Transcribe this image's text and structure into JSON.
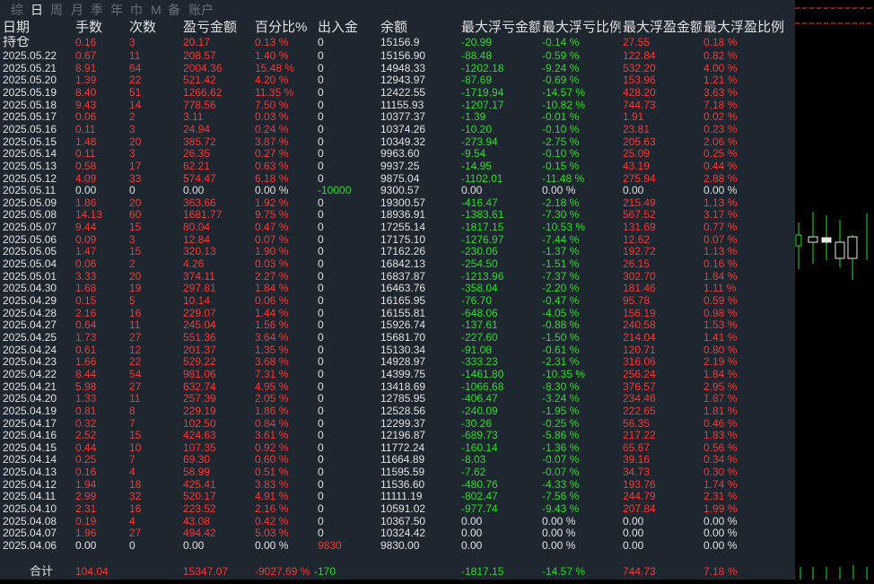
{
  "tabs": [
    {
      "label": "综",
      "active": false
    },
    {
      "label": "日",
      "active": true
    },
    {
      "label": "周",
      "active": false
    },
    {
      "label": "月",
      "active": false
    },
    {
      "label": "季",
      "active": false
    },
    {
      "label": "年",
      "active": false
    },
    {
      "label": "巾",
      "active": false
    },
    {
      "label": "M",
      "active": false
    },
    {
      "label": "备",
      "active": false
    },
    {
      "label": "账户",
      "active": false
    }
  ],
  "headers": [
    "日期",
    "手数",
    "次数",
    "盈亏金额",
    "百分比%",
    "出入金",
    "余额",
    "最大浮亏金额",
    "最大浮亏比例",
    "最大浮盈金额",
    "最大浮盈比例"
  ],
  "holding": [
    "持仓",
    "0.16",
    "3",
    "20.17",
    "0.13 %",
    "0",
    "15156.9",
    "-20.99",
    "-0.14 %",
    "27.55",
    "0.18 %"
  ],
  "rows": [
    [
      "2025.05.22",
      "0.67",
      "11",
      "208.57",
      "1.40 %",
      "0",
      "15156.90",
      "-88.48",
      "-0.59 %",
      "122.84",
      "0.82 %"
    ],
    [
      "2025.05.21",
      "8.91",
      "64",
      "2004.36",
      "15.48 %",
      "0",
      "14948.33",
      "-1202.18",
      "-9.24 %",
      "532.20",
      "4.00 %"
    ],
    [
      "2025.05.20",
      "1.39",
      "22",
      "521.42",
      "4.20 %",
      "0",
      "12943.97",
      "-87.69",
      "-0.69 %",
      "153.96",
      "1.21 %"
    ],
    [
      "2025.05.19",
      "8.40",
      "51",
      "1266.62",
      "11.35 %",
      "0",
      "12422.55",
      "-1719.94",
      "-14.57 %",
      "428.20",
      "3.63 %"
    ],
    [
      "2025.05.18",
      "9.43",
      "14",
      "778.56",
      "7.50 %",
      "0",
      "11155.93",
      "-1207.17",
      "-10.82 %",
      "744.73",
      "7.18 %"
    ],
    [
      "2025.05.17",
      "0.06",
      "2",
      "3.11",
      "0.03 %",
      "0",
      "10377.37",
      "-1.39",
      "-0.01 %",
      "1.91",
      "0.02 %"
    ],
    [
      "2025.05.16",
      "0.11",
      "3",
      "24.94",
      "0.24 %",
      "0",
      "10374.26",
      "-10.20",
      "-0.10 %",
      "23.81",
      "0.23 %"
    ],
    [
      "2025.05.15",
      "1.48",
      "20",
      "385.72",
      "3.87 %",
      "0",
      "10349.32",
      "-273.94",
      "-2.75 %",
      "205.63",
      "2.06 %"
    ],
    [
      "2025.05.14",
      "0.11",
      "3",
      "26.35",
      "0.27 %",
      "0",
      "9963.60",
      "-9.54",
      "-0.10 %",
      "25.09",
      "0.25 %"
    ],
    [
      "2025.05.13",
      "0.58",
      "17",
      "62.21",
      "0.63 %",
      "0",
      "9937.25",
      "-14.95",
      "-0.15 %",
      "43.19",
      "0.44 %"
    ],
    [
      "2025.05.12",
      "4.09",
      "33",
      "574.47",
      "6.18 %",
      "0",
      "9875.04",
      "-1102.01",
      "-11.48 %",
      "275.94",
      "2.88 %"
    ],
    [
      "2025.05.11",
      "0.00",
      "0",
      "0.00",
      "0.00 %",
      "-10000",
      "9300.57",
      "0.00",
      "0.00 %",
      "0.00",
      "0.00 %"
    ],
    [
      "2025.05.09",
      "1.86",
      "20",
      "363.66",
      "1.92 %",
      "0",
      "19300.57",
      "-416.47",
      "-2.18 %",
      "215.49",
      "1.13 %"
    ],
    [
      "2025.05.08",
      "14.13",
      "60",
      "1681.77",
      "9.75 %",
      "0",
      "18936.91",
      "-1383.61",
      "-7.30 %",
      "567.52",
      "3.17 %"
    ],
    [
      "2025.05.07",
      "9.44",
      "15",
      "80.04",
      "0.47 %",
      "0",
      "17255.14",
      "-1817.15",
      "-10.53 %",
      "131.69",
      "0.77 %"
    ],
    [
      "2025.05.06",
      "0.09",
      "3",
      "12.84",
      "0.07 %",
      "0",
      "17175.10",
      "-1276.97",
      "-7.44 %",
      "12.62",
      "0.07 %"
    ],
    [
      "2025.05.05",
      "1.47",
      "15",
      "320.13",
      "1.90 %",
      "0",
      "17162.26",
      "-230.06",
      "-1.37 %",
      "192.72",
      "1.13 %"
    ],
    [
      "2025.05.04",
      "0.06",
      "2",
      "4.26",
      "0.03 %",
      "0",
      "16842.13",
      "-254.50",
      "-1.51 %",
      "26.15",
      "0.16 %"
    ],
    [
      "2025.05.01",
      "3.33",
      "20",
      "374.11",
      "2.27 %",
      "0",
      "16837.87",
      "-1213.96",
      "-7.37 %",
      "302.70",
      "1.84 %"
    ],
    [
      "2025.04.30",
      "1.68",
      "19",
      "297.81",
      "1.84 %",
      "0",
      "16463.76",
      "-358.04",
      "-2.20 %",
      "181.46",
      "1.11 %"
    ],
    [
      "2025.04.29",
      "0.15",
      "5",
      "10.14",
      "0.06 %",
      "0",
      "16165.95",
      "-76.70",
      "-0.47 %",
      "95.78",
      "0.59 %"
    ],
    [
      "2025.04.28",
      "2.16",
      "16",
      "229.07",
      "1.44 %",
      "0",
      "16155.81",
      "-648.06",
      "-4.05 %",
      "156.19",
      "0.98 %"
    ],
    [
      "2025.04.27",
      "0.64",
      "11",
      "245.04",
      "1.56 %",
      "0",
      "15926.74",
      "-137.61",
      "-0.88 %",
      "240.58",
      "1.53 %"
    ],
    [
      "2025.04.25",
      "1.73",
      "27",
      "551.36",
      "3.64 %",
      "0",
      "15681.70",
      "-227.60",
      "-1.50 %",
      "214.04",
      "1.41 %"
    ],
    [
      "2025.04.24",
      "0.61",
      "12",
      "201.37",
      "1.35 %",
      "0",
      "15130.34",
      "-91.08",
      "-0.61 %",
      "120.71",
      "0.80 %"
    ],
    [
      "2025.04.23",
      "1.66",
      "22",
      "529.22",
      "3.68 %",
      "0",
      "14928.97",
      "-333.23",
      "-2.31 %",
      "316.06",
      "2.19 %"
    ],
    [
      "2025.04.22",
      "8.44",
      "54",
      "981.06",
      "7.31 %",
      "0",
      "14399.75",
      "-1461.80",
      "-10.35 %",
      "256.24",
      "1.84 %"
    ],
    [
      "2025.04.21",
      "5.98",
      "27",
      "632.74",
      "4.95 %",
      "0",
      "13418.69",
      "-1066.68",
      "-8.30 %",
      "376.57",
      "2.95 %"
    ],
    [
      "2025.04.20",
      "1.33",
      "11",
      "257.39",
      "2.05 %",
      "0",
      "12785.95",
      "-406.47",
      "-3.24 %",
      "234.46",
      "1.87 %"
    ],
    [
      "2025.04.19",
      "0.81",
      "8",
      "229.19",
      "1.86 %",
      "0",
      "12528.56",
      "-240.09",
      "-1.95 %",
      "222.65",
      "1.81 %"
    ],
    [
      "2025.04.17",
      "0.32",
      "7",
      "102.50",
      "0.84 %",
      "0",
      "12299.37",
      "-30.26",
      "-0.25 %",
      "56.35",
      "0.46 %"
    ],
    [
      "2025.04.16",
      "2.52",
      "15",
      "424.63",
      "3.61 %",
      "0",
      "12196.87",
      "-689.73",
      "-5.86 %",
      "217.22",
      "1.83 %"
    ],
    [
      "2025.04.15",
      "0.44",
      "10",
      "107.35",
      "0.92 %",
      "0",
      "11772.24",
      "-160.14",
      "-1.36 %",
      "65.67",
      "0.56 %"
    ],
    [
      "2025.04.14",
      "0.25",
      "7",
      "69.30",
      "0.60 %",
      "0",
      "11664.89",
      "-8.03",
      "-0.07 %",
      "39.16",
      "0.34 %"
    ],
    [
      "2025.04.13",
      "0.16",
      "4",
      "58.99",
      "0.51 %",
      "0",
      "11595.59",
      "-7.62",
      "-0.07 %",
      "34.73",
      "0.30 %"
    ],
    [
      "2025.04.12",
      "1.94",
      "18",
      "425.41",
      "3.83 %",
      "0",
      "11536.60",
      "-480.76",
      "-4.33 %",
      "193.76",
      "1.74 %"
    ],
    [
      "2025.04.11",
      "2.99",
      "32",
      "520.17",
      "4.91 %",
      "0",
      "11111.19",
      "-802.47",
      "-7.56 %",
      "244.79",
      "2.31 %"
    ],
    [
      "2025.04.10",
      "2.31",
      "16",
      "223.52",
      "2.16 %",
      "0",
      "10591.02",
      "-977.74",
      "-9.43 %",
      "207.84",
      "1.99 %"
    ],
    [
      "2025.04.08",
      "0.19",
      "4",
      "43.08",
      "0.42 %",
      "0",
      "10367.50",
      "0.00",
      "0.00 %",
      "0.00",
      "0.00 %"
    ],
    [
      "2025.04.07",
      "1.96",
      "27",
      "494.42",
      "5.03 %",
      "0",
      "10324.42",
      "0.00",
      "0.00 %",
      "0.00",
      "0.00 %"
    ],
    [
      "2025.04.06",
      "0.00",
      "0",
      "0.00",
      "0.00 %",
      "9830",
      "9830.00",
      "0.00",
      "0.00 %",
      "0.00",
      "0.00 %"
    ]
  ],
  "total": {
    "label": "合计",
    "lots": "104.04",
    "profit": "15347.07",
    "percent": "-9027.69 %",
    "deposit": "-170",
    "max_loss": "-1817.15",
    "max_loss_pct": "-14.57 %",
    "max_gain": "744.73",
    "max_gain_pct": "7.18 %"
  },
  "colors": {
    "panel_bg": "#1e262f",
    "white": "#e2e2e2",
    "red": "#ff3333",
    "green": "#22e022",
    "dashed_line": "#ff3333"
  }
}
